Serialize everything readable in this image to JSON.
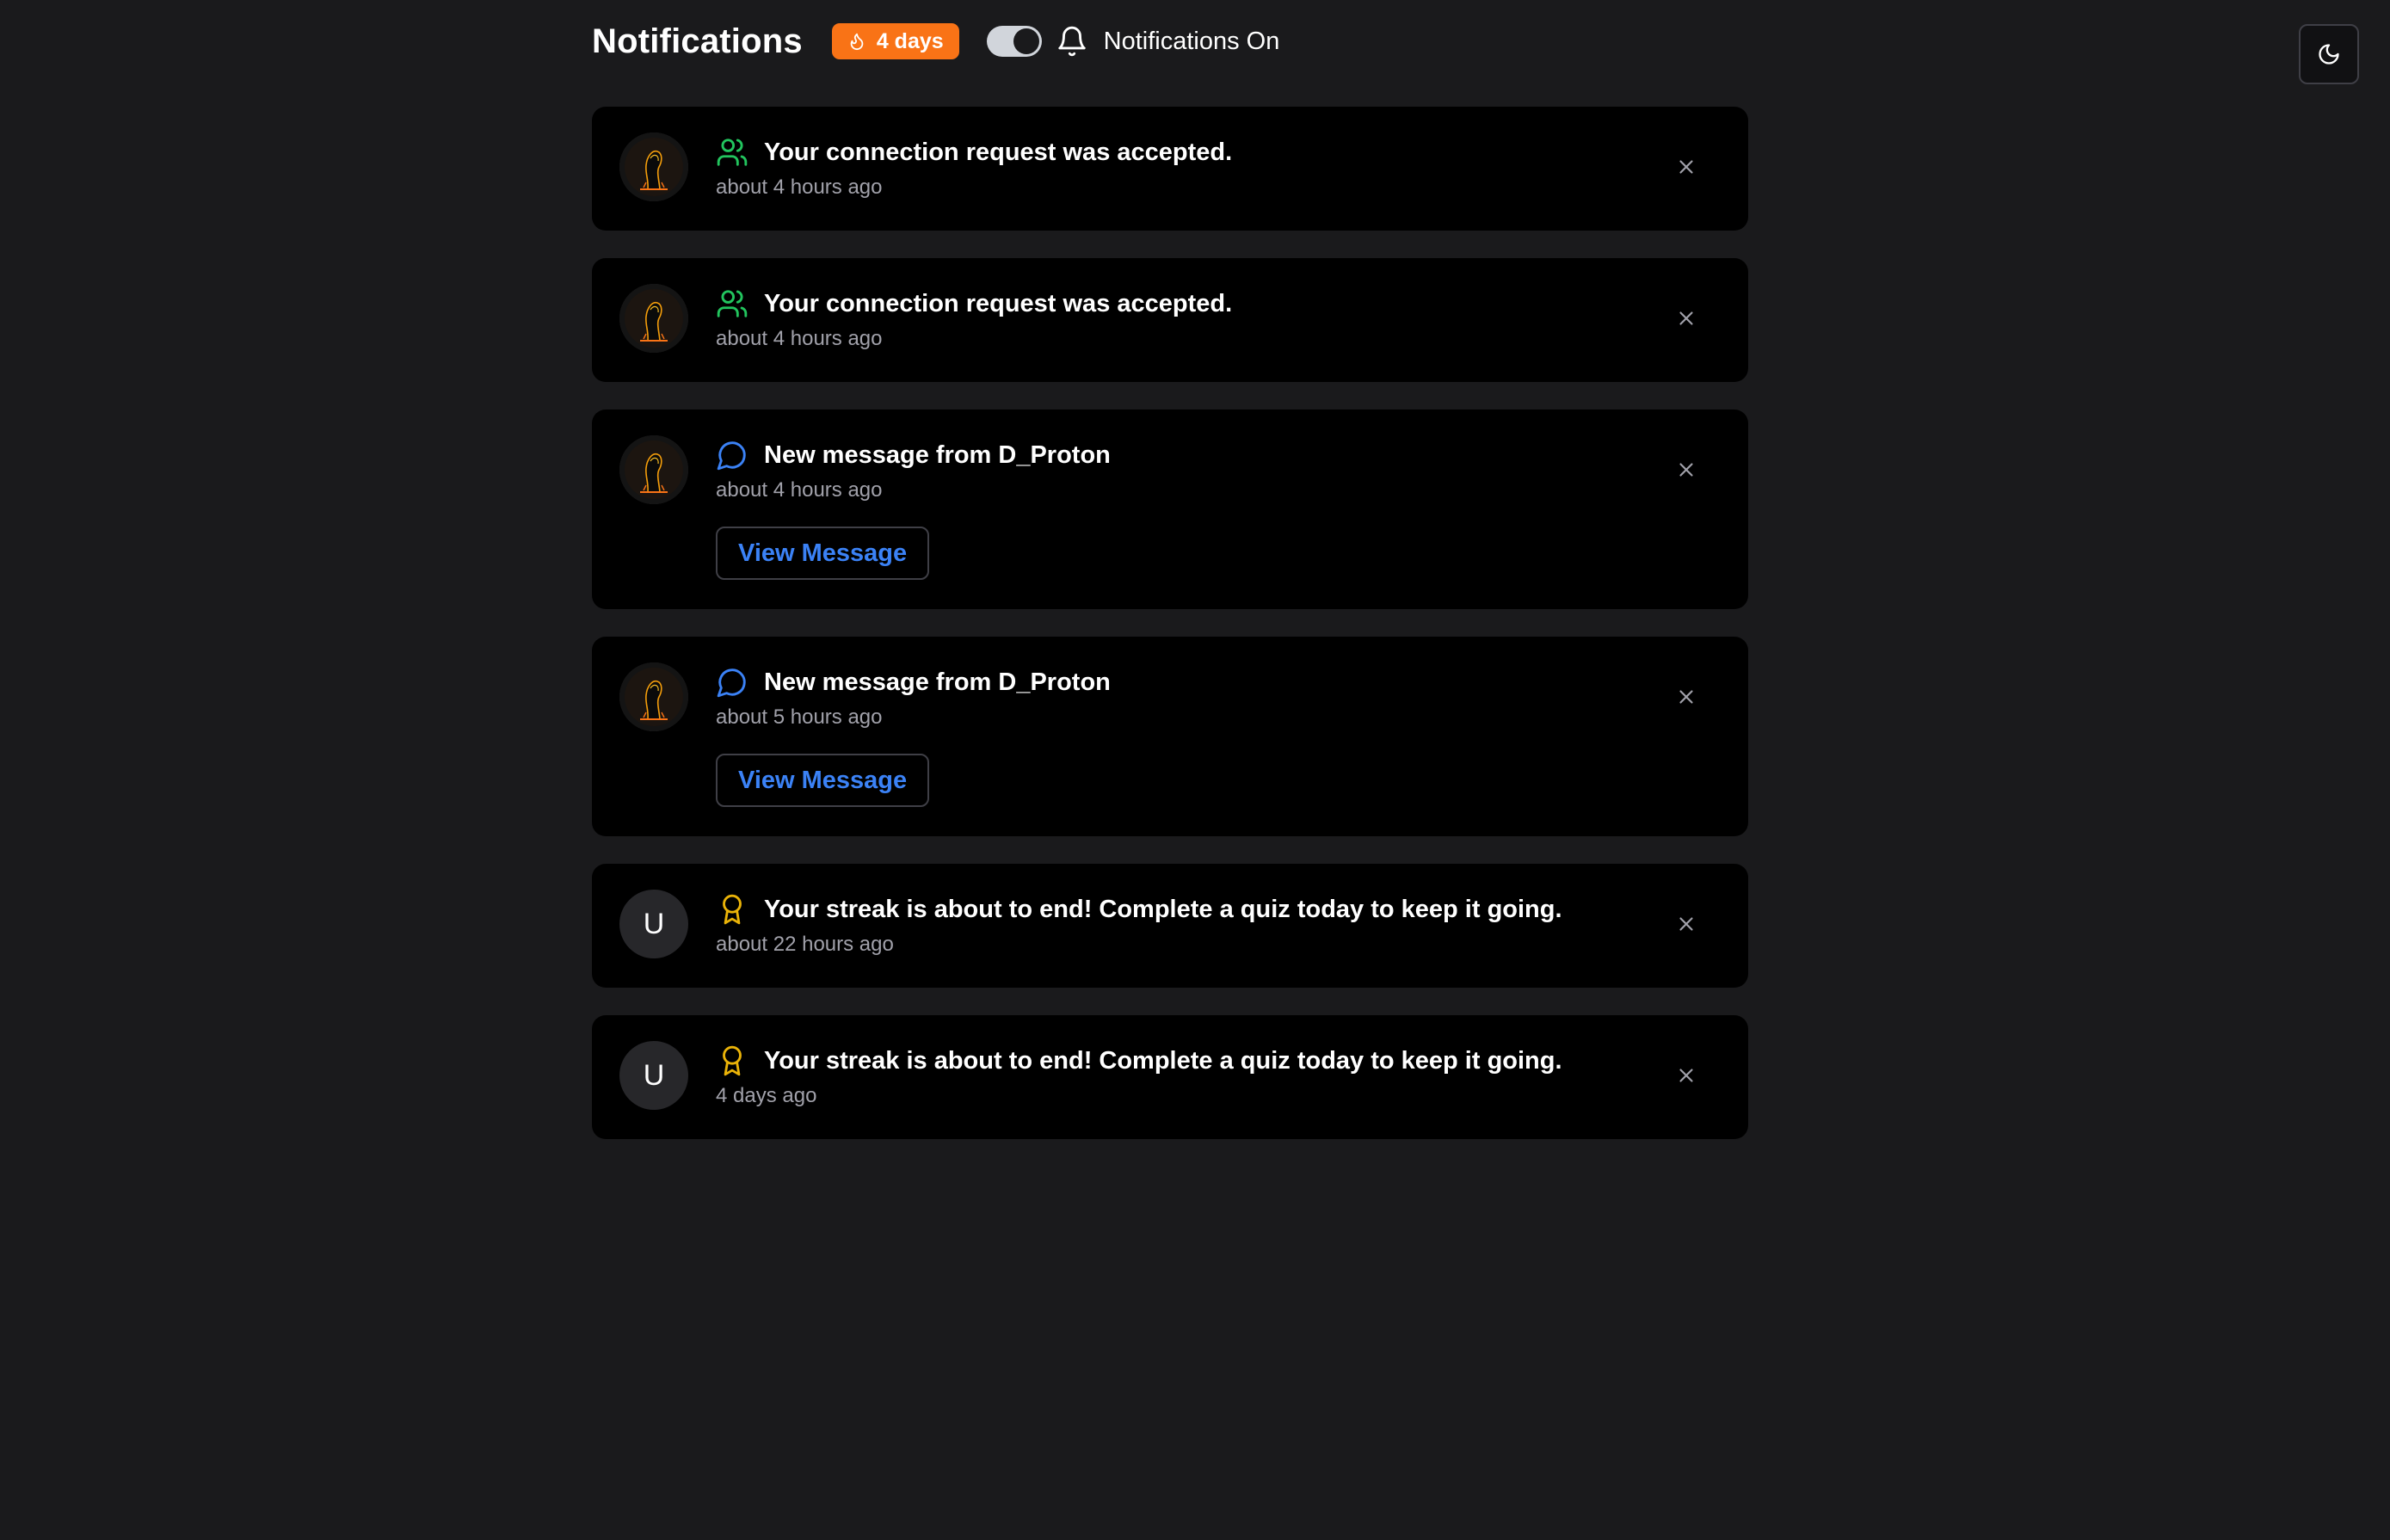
{
  "header": {
    "title": "Notifications",
    "streak": "4 days",
    "toggle_label": "Notifications On",
    "toggle_on": true
  },
  "colors": {
    "accent_orange": "#f97316",
    "connection_green": "#22c55e",
    "message_blue": "#3b82f6",
    "streak_gold": "#eab308"
  },
  "notifications": [
    {
      "type": "connection",
      "icon": "users-icon",
      "message": "Your connection request was accepted.",
      "time": "about 4 hours ago"
    },
    {
      "type": "connection",
      "icon": "users-icon",
      "message": "Your connection request was accepted.",
      "time": "about 4 hours ago"
    },
    {
      "type": "message",
      "icon": "message-circle-icon",
      "message": "New message from D_Proton",
      "time": "about 4 hours ago",
      "action": "View Message"
    },
    {
      "type": "message",
      "icon": "message-circle-icon",
      "message": "New message from D_Proton",
      "time": "about 5 hours ago",
      "action": "View Message"
    },
    {
      "type": "streak",
      "icon": "award-icon",
      "avatar_letter": "U",
      "message": "Your streak is about to end! Complete a quiz today to keep it going.",
      "time": "about 22 hours ago"
    },
    {
      "type": "streak",
      "icon": "award-icon",
      "avatar_letter": "U",
      "message": "Your streak is about to end! Complete a quiz today to keep it going.",
      "time": "4 days ago"
    }
  ]
}
